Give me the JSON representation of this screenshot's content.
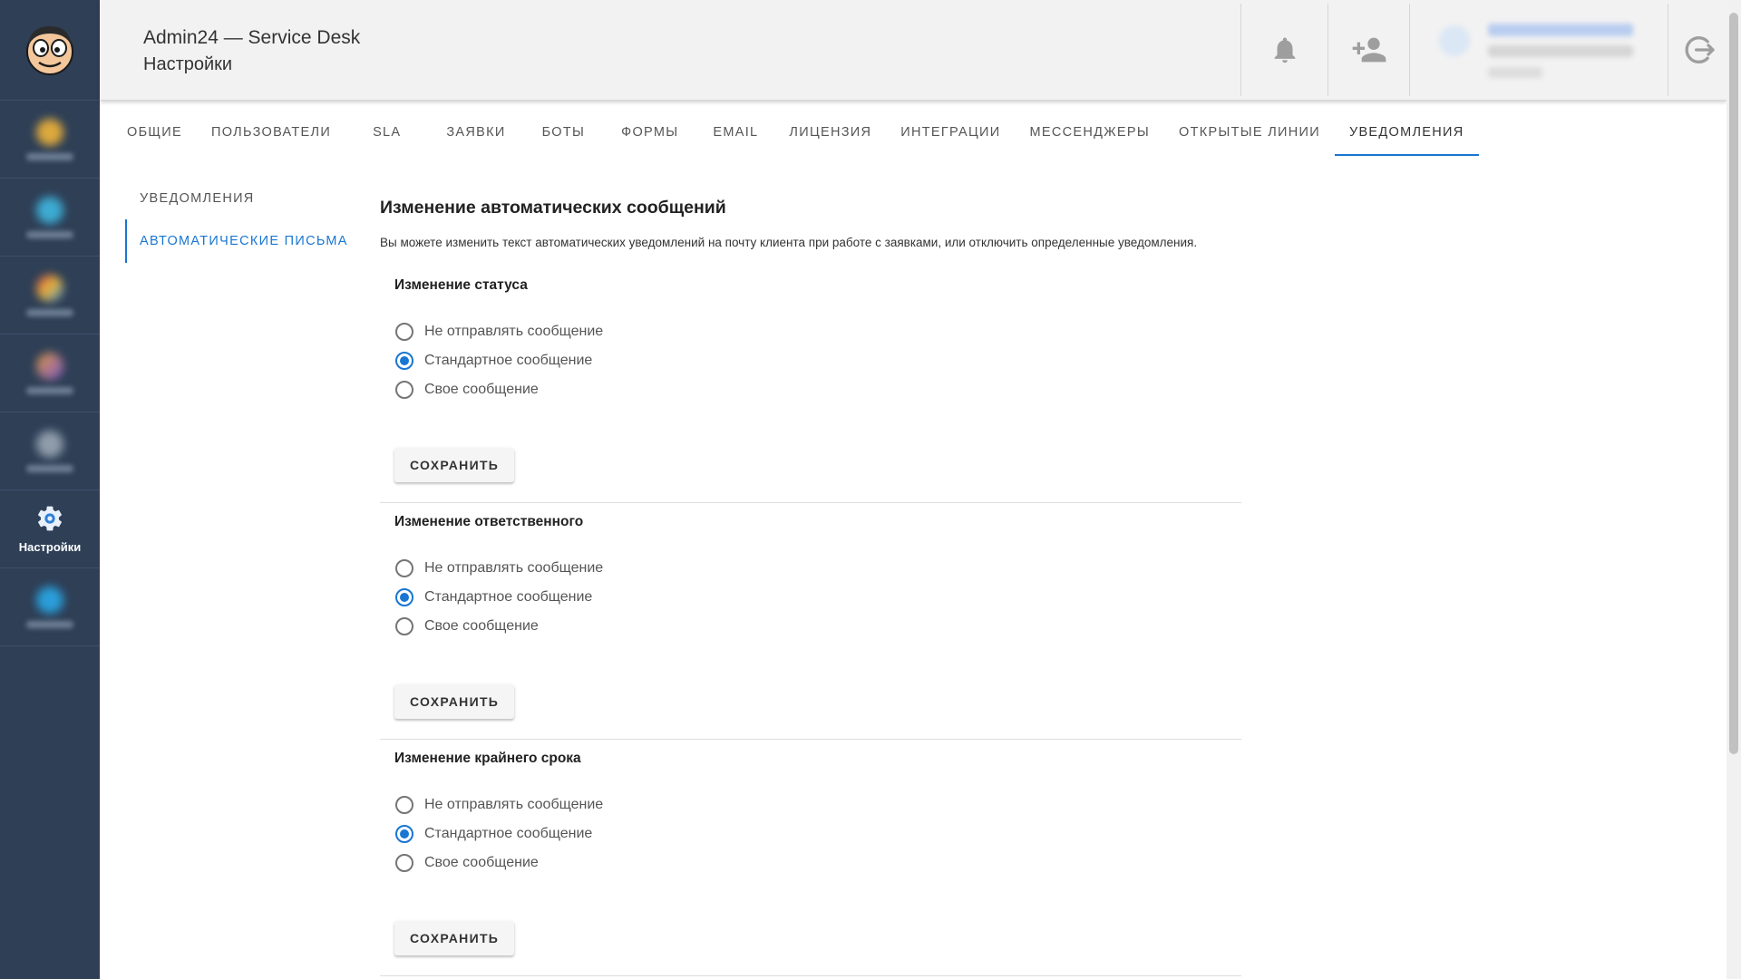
{
  "colors": {
    "sidebar_bg": "#2e3f56",
    "accent": "#1976d2",
    "header_bg": "#f2f2f2"
  },
  "header": {
    "app_title": "Admin24 — Service Desk",
    "page_title": "Настройки",
    "icons": [
      "bell-icon",
      "add-user-icon",
      "logout-icon"
    ]
  },
  "sidebar": {
    "items": [
      {
        "label": "",
        "icon": "blurred-module-icon-1"
      },
      {
        "label": "",
        "icon": "blurred-module-icon-2"
      },
      {
        "label": "",
        "icon": "blurred-module-icon-3"
      },
      {
        "label": "",
        "icon": "blurred-module-icon-4"
      },
      {
        "label": "",
        "icon": "blurred-module-icon-5"
      },
      {
        "label": "Настройки",
        "icon": "gear-icon",
        "active": true
      },
      {
        "label": "",
        "icon": "blurred-module-icon-7"
      }
    ]
  },
  "tabs": [
    {
      "label": "Общие"
    },
    {
      "label": "Пользователи"
    },
    {
      "label": "SLA"
    },
    {
      "label": "Заявки"
    },
    {
      "label": "Боты"
    },
    {
      "label": "Формы"
    },
    {
      "label": "Email"
    },
    {
      "label": "Лицензия"
    },
    {
      "label": "Интеграции"
    },
    {
      "label": "Мессенджеры"
    },
    {
      "label": "Открытые линии"
    },
    {
      "label": "Уведомления",
      "active": true
    }
  ],
  "subnav": [
    {
      "label": "Уведомления"
    },
    {
      "label": "Автоматические письма",
      "active": true
    }
  ],
  "main": {
    "title": "Изменение автоматических сообщений",
    "description": "Вы можете изменить текст автоматических уведомлений на почту клиента при работе с заявками, или отключить определенные уведомления.",
    "sections": [
      {
        "title": "Изменение статуса",
        "options": [
          "Не отправлять сообщение",
          "Стандартное сообщение",
          "Свое сообщение"
        ],
        "selected": "Стандартное сообщение",
        "save_label": "Сохранить"
      },
      {
        "title": "Изменение ответственного",
        "options": [
          "Не отправлять сообщение",
          "Стандартное сообщение",
          "Свое сообщение"
        ],
        "selected": "Стандартное сообщение",
        "save_label": "Сохранить"
      },
      {
        "title": "Изменение крайнего срока",
        "options": [
          "Не отправлять сообщение",
          "Стандартное сообщение",
          "Свое сообщение"
        ],
        "selected": "Стандартное сообщение",
        "save_label": "Сохранить"
      }
    ]
  }
}
